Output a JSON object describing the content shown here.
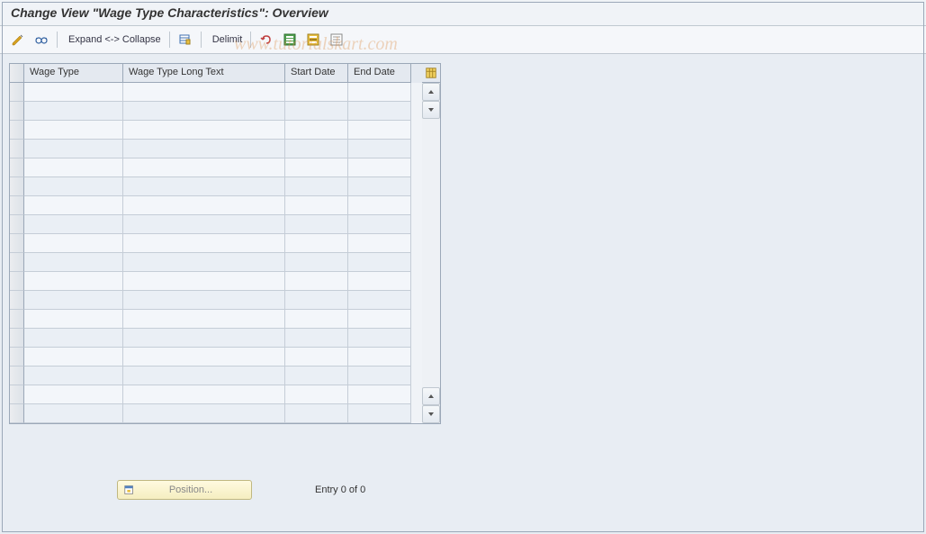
{
  "title": "Change View \"Wage Type Characteristics\": Overview",
  "toolbar": {
    "expand": "Expand <->",
    "collapse": "Collapse",
    "delimit": "Delimit"
  },
  "icons": {
    "modify": "modify-icon",
    "glasses": "details-icon",
    "table": "table-icon",
    "undo": "undo-icon",
    "select_all": "select-all-icon",
    "select_block": "select-block-icon",
    "deselect": "deselect-icon",
    "config": "config-icon"
  },
  "columns": {
    "wage_type": "Wage Type",
    "long_text": "Wage Type Long Text",
    "start_date": "Start Date",
    "end_date": "End Date"
  },
  "table_rows": 18,
  "footer": {
    "position_label": "Position...",
    "entry_text": "Entry 0 of 0"
  },
  "watermark": "www.tutorialskart.com"
}
